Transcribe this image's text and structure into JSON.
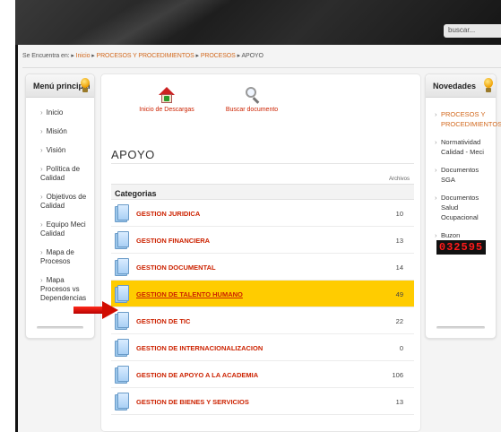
{
  "header": {
    "search_placeholder": "buscar...",
    "search_icon": "search-icon"
  },
  "breadcrumb": {
    "prefix": "Se Encuentra en:",
    "items": [
      "Inicio",
      "PROCESOS Y PROCEDIMIENTOS",
      "PROCESOS",
      "APOYO"
    ],
    "separator": "▸"
  },
  "sidebar": {
    "title": "Menú principal",
    "items": [
      {
        "label": "Inicio"
      },
      {
        "label": "Misión"
      },
      {
        "label": "Visión"
      },
      {
        "label": "Política de Calidad"
      },
      {
        "label": "Objetivos de Calidad"
      },
      {
        "label": "Equipo Meci Calidad"
      },
      {
        "label": "Mapa de Procesos"
      },
      {
        "label": "Mapa Procesos vs Dependencias"
      }
    ]
  },
  "main": {
    "tools": [
      {
        "label": "Inicio de Descargas",
        "icon": "home-download-icon"
      },
      {
        "label": "Buscar documento",
        "icon": "magnifier-icon"
      }
    ],
    "section_title": "APOYO",
    "column_header": "Archivos",
    "categories_header": "Categorias",
    "categories": [
      {
        "name": "GESTION JURIDICA",
        "count": "10",
        "selected": false
      },
      {
        "name": "GESTION FINANCIERA",
        "count": "13",
        "selected": false
      },
      {
        "name": "GESTION DOCUMENTAL",
        "count": "14",
        "selected": false
      },
      {
        "name": "GESTION DE TALENTO HUMANO",
        "count": "49",
        "selected": true
      },
      {
        "name": "GESTION DE TIC",
        "count": "22",
        "selected": false
      },
      {
        "name": "GESTION DE INTERNACIONALIZACION",
        "count": "0",
        "selected": false
      },
      {
        "name": "GESTION DE APOYO A LA ACADEMIA",
        "count": "106",
        "selected": false
      },
      {
        "name": "GESTION DE BIENES Y SERVICIOS",
        "count": "13",
        "selected": false
      }
    ]
  },
  "novedades": {
    "title": "Novedades",
    "items": [
      {
        "label": "PROCESOS Y PROCEDIMIENTOS",
        "active": true
      },
      {
        "label": "Normatividad Calidad - Meci",
        "active": false
      },
      {
        "label": "Documentos SGA",
        "active": false
      },
      {
        "label": "Documentos Salud Ocupacional",
        "active": false
      },
      {
        "label": "Buzon",
        "active": false
      }
    ],
    "visit_counter": "032595"
  },
  "colors": {
    "link_red": "#cc2200",
    "breadcrumb_orange": "#d2691e",
    "selected_row": "#ffcc00",
    "counter_digits": "#ff1a1a"
  }
}
